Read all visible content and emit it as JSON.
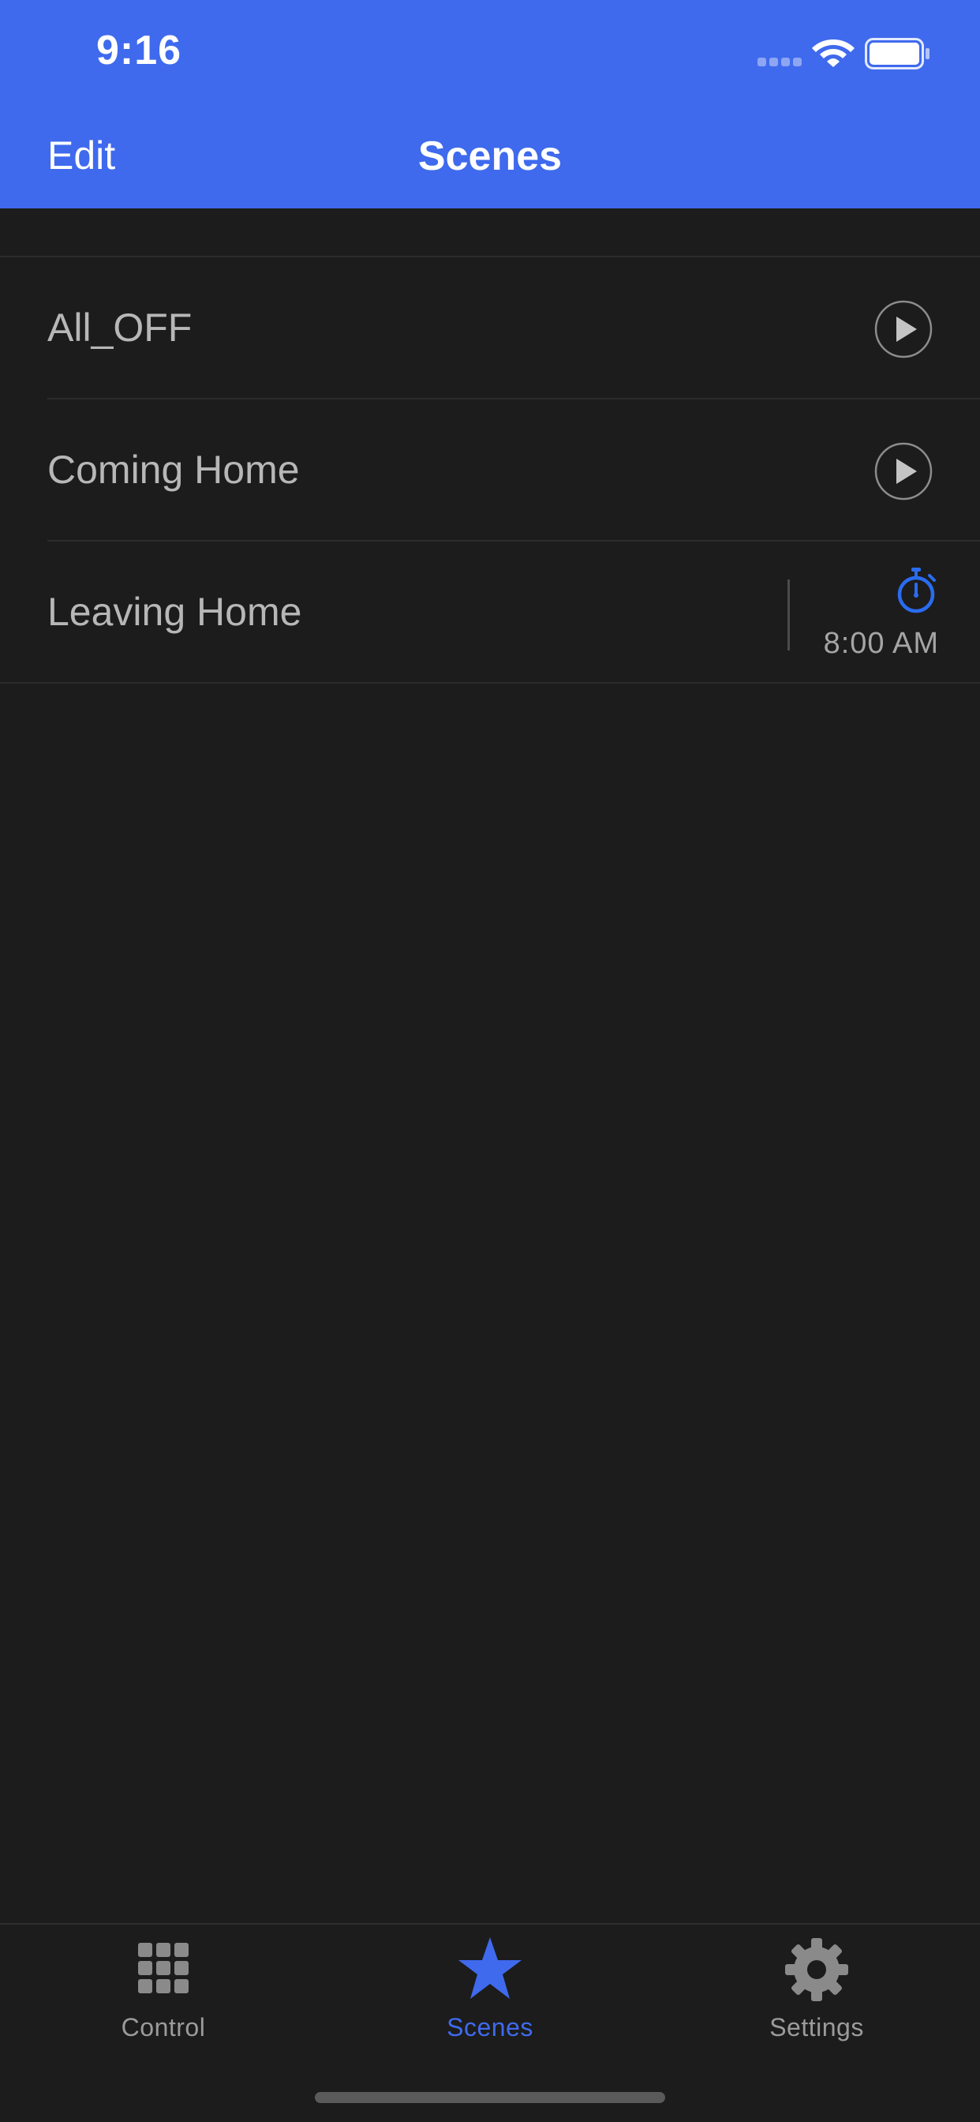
{
  "status_bar": {
    "time": "9:16"
  },
  "nav": {
    "edit_label": "Edit",
    "title": "Scenes"
  },
  "scenes": [
    {
      "name": "All_OFF",
      "action": "play-icon"
    },
    {
      "name": "Coming Home",
      "action": "play-icon"
    },
    {
      "name": "Leaving Home",
      "action": "timer-icon",
      "scheduled_time": "8:00 AM"
    }
  ],
  "tabs": [
    {
      "label": "Control",
      "icon": "grid-icon",
      "active": false
    },
    {
      "label": "Scenes",
      "icon": "star-icon",
      "active": true
    },
    {
      "label": "Settings",
      "icon": "gear-icon",
      "active": false
    }
  ],
  "colors": {
    "accent": "#3f6aed",
    "timer": "#2a6cf0",
    "background": "#1c1c1c"
  }
}
